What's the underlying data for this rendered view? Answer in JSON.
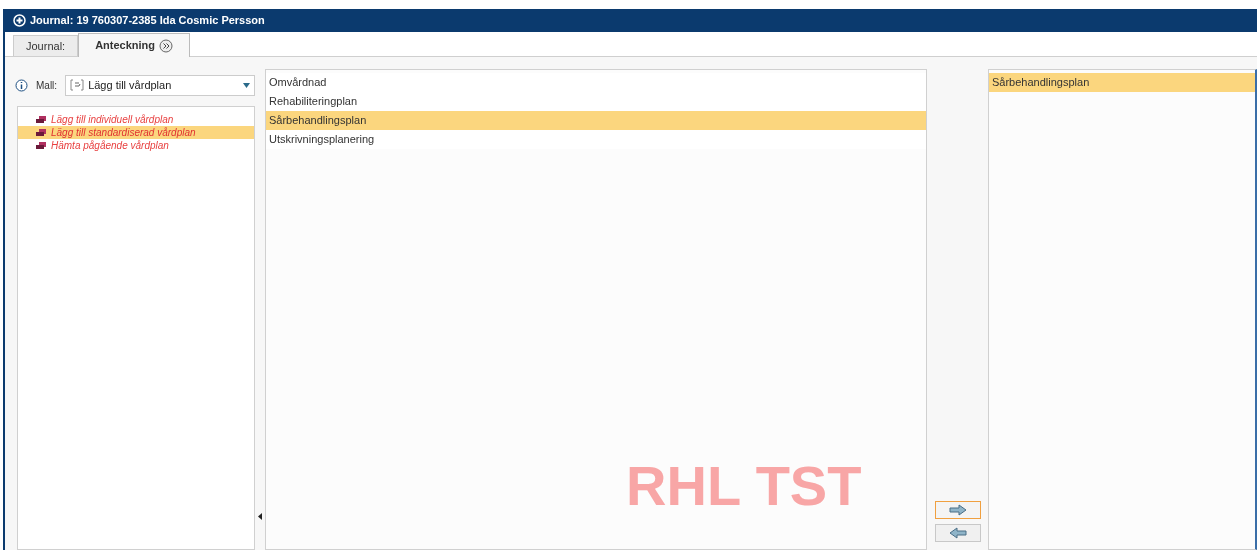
{
  "window": {
    "title": "Journal: 19 760307-2385 Ida Cosmic Persson"
  },
  "tabs": [
    {
      "label": "Journal:",
      "selected": false
    },
    {
      "label": "Anteckning",
      "selected": true
    }
  ],
  "template": {
    "label": "Mall:",
    "value": "Lägg till vårdplan"
  },
  "actions": [
    {
      "label": "Lägg till individuell vårdplan",
      "selected": false
    },
    {
      "label": "Lägg till standardiserad vårdplan",
      "selected": true
    },
    {
      "label": "Hämta pågående vårdplan",
      "selected": false
    }
  ],
  "available": [
    {
      "label": "Omvårdnad",
      "selected": false
    },
    {
      "label": "Rehabiliteringplan",
      "selected": false
    },
    {
      "label": "Sårbehandlingsplan",
      "selected": true
    },
    {
      "label": "Utskrivningsplanering",
      "selected": false
    }
  ],
  "chosen": [
    {
      "label": "Sårbehandlingsplan",
      "selected": true
    }
  ],
  "environment_label": "RHL TST"
}
